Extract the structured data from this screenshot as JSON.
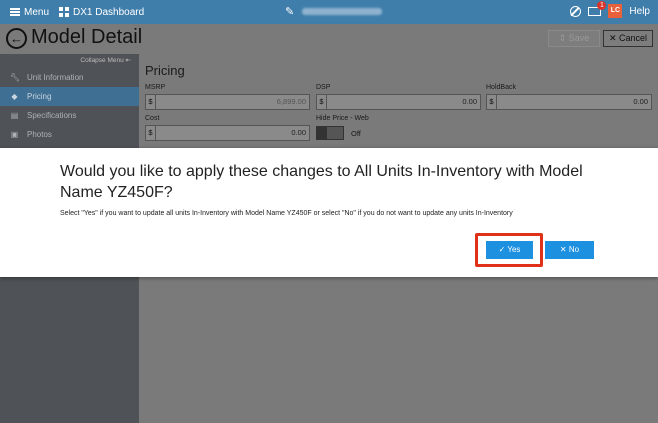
{
  "topbar": {
    "menu_label": "Menu",
    "dashboard_label": "DX1 Dashboard",
    "badge_count": "1",
    "avatar_initials": "LC",
    "help_label": "Help"
  },
  "header": {
    "title": "Model Detail",
    "save_label": "Save",
    "cancel_label": "Cancel"
  },
  "sidebar": {
    "collapse_label": "Collapse Menu",
    "items": [
      {
        "label": "Unit Information",
        "icon": "wrench-icon"
      },
      {
        "label": "Pricing",
        "icon": "tag-icon"
      },
      {
        "label": "Specifications",
        "icon": "document-icon"
      },
      {
        "label": "Photos",
        "icon": "image-icon"
      }
    ]
  },
  "pricing": {
    "title": "Pricing",
    "msrp_label": "MSRP",
    "msrp_value": "6,899.00",
    "dsp_label": "DSP",
    "dsp_value": "0.00",
    "holdback_label": "HoldBack",
    "holdback_value": "0.00",
    "cost_label": "Cost",
    "cost_value": "0.00",
    "hide_price_label": "Hide Price - Web",
    "hide_price_state": "Off",
    "currency": "$"
  },
  "modal": {
    "title": "Would you like to apply these changes to All Units In-Inventory with Model Name YZ450F?",
    "text": "Select \"Yes\" if you want to update all units In-Inventory with Model Name YZ450F or select \"No\" if you do not want to update any units In-Inventory",
    "yes_label": "Yes",
    "no_label": "No"
  },
  "colors": {
    "topbar": "#3f7eab",
    "accent": "#1e90e0",
    "highlight": "#e03018"
  }
}
